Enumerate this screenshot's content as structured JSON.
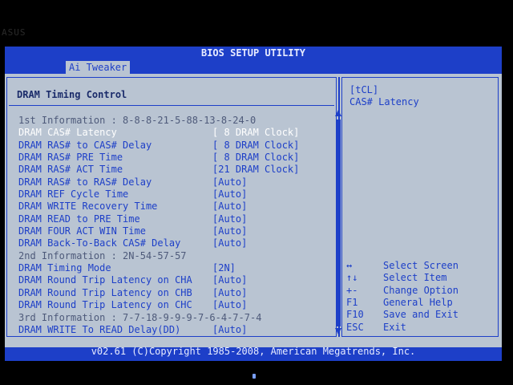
{
  "watermark": "ASUS",
  "title": "BIOS SETUP UTILITY",
  "tabs": [
    {
      "label": "Ai Tweaker"
    }
  ],
  "section_title": "DRAM Timing Control",
  "items": [
    {
      "label": "1st Information : 8-8-8-21-5-88-13-8-24-0",
      "value": "",
      "kind": "info"
    },
    {
      "label": "DRAM CAS# Latency",
      "value": "[ 8 DRAM Clock]",
      "kind": "selected"
    },
    {
      "label": "DRAM RAS# to CAS# Delay",
      "value": "[ 8 DRAM Clock]",
      "kind": "option"
    },
    {
      "label": "DRAM RAS# PRE Time",
      "value": "[ 8 DRAM Clock]",
      "kind": "option"
    },
    {
      "label": "DRAM RAS# ACT Time",
      "value": "[21 DRAM Clock]",
      "kind": "option"
    },
    {
      "label": "DRAM RAS# to RAS# Delay",
      "value": "[Auto]",
      "kind": "option"
    },
    {
      "label": "DRAM REF Cycle Time",
      "value": "[Auto]",
      "kind": "option"
    },
    {
      "label": "DRAM WRITE Recovery Time",
      "value": "[Auto]",
      "kind": "option"
    },
    {
      "label": "DRAM READ to PRE Time",
      "value": "[Auto]",
      "kind": "option"
    },
    {
      "label": "DRAM FOUR ACT WIN Time",
      "value": "[Auto]",
      "kind": "option"
    },
    {
      "label": "DRAM Back-To-Back CAS# Delay",
      "value": "[Auto]",
      "kind": "option"
    },
    {
      "label": "2nd Information : 2N-54-57-57",
      "value": "",
      "kind": "info"
    },
    {
      "label": "DRAM Timing Mode",
      "value": "[2N]",
      "kind": "option"
    },
    {
      "label": "DRAM Round Trip Latency on CHA",
      "value": "[Auto]",
      "kind": "option"
    },
    {
      "label": "DRAM Round Trip Latency on CHB",
      "value": "[Auto]",
      "kind": "option"
    },
    {
      "label": "DRAM Round Trip Latency on CHC",
      "value": "[Auto]",
      "kind": "option"
    },
    {
      "label": "3rd Information : 7-7-18-9-9-9-7-6-4-7-7-4",
      "value": "",
      "kind": "info"
    },
    {
      "label": "DRAM WRITE To READ Delay(DD)",
      "value": "[Auto]",
      "kind": "option"
    }
  ],
  "help": {
    "line1": "[tCL]",
    "line2": "CAS# Latency"
  },
  "keys": [
    {
      "key": "↔",
      "desc": "Select Screen"
    },
    {
      "key": "↑↓",
      "desc": "Select Item"
    },
    {
      "key": "+-",
      "desc": "Change Option"
    },
    {
      "key": "F1",
      "desc": "General Help"
    },
    {
      "key": "F10",
      "desc": "Save and Exit"
    },
    {
      "key": "ESC",
      "desc": "Exit"
    }
  ],
  "footer": "v02.61 (C)Copyright 1985-2008, American Megatrends, Inc."
}
